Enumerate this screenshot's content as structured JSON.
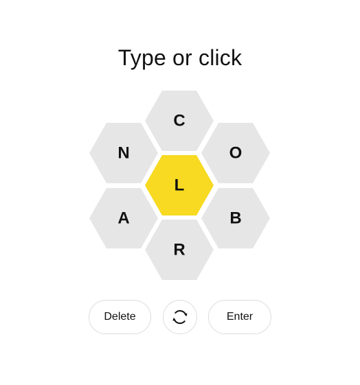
{
  "prompt": "Type or click",
  "hive": {
    "center": {
      "letter": "L",
      "color": "#f7da21"
    },
    "outer_color": "#e6e6e6",
    "cells": [
      {
        "name": "hive-cell-top",
        "letter": "C"
      },
      {
        "name": "hive-cell-upper-right",
        "letter": "O"
      },
      {
        "name": "hive-cell-lower-right",
        "letter": "B"
      },
      {
        "name": "hive-cell-bottom",
        "letter": "R"
      },
      {
        "name": "hive-cell-lower-left",
        "letter": "A"
      },
      {
        "name": "hive-cell-upper-left",
        "letter": "N"
      }
    ]
  },
  "controls": {
    "delete_label": "Delete",
    "shuffle_icon": "shuffle-icon",
    "enter_label": "Enter"
  }
}
